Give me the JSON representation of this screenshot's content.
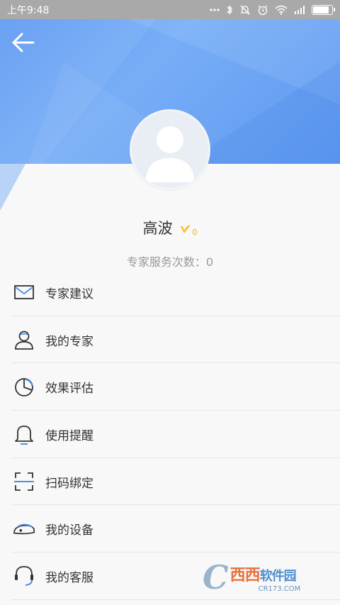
{
  "status_bar": {
    "time": "上午9:48",
    "icons": [
      "more-dots-icon",
      "bluetooth-icon",
      "mute-icon",
      "alarm-icon",
      "wifi-icon",
      "signal-icon",
      "battery-icon"
    ],
    "battery_level": 0.8
  },
  "header": {
    "back_icon": "arrow-left-icon",
    "color": "#5f9af3"
  },
  "profile": {
    "name": "高波",
    "vip_badge": "V",
    "vip_level": "0",
    "service_count_label": "专家服务次数：0"
  },
  "menu": [
    {
      "label": "专家建议",
      "icon": "mail-icon"
    },
    {
      "label": "我的专家",
      "icon": "expert-person-icon"
    },
    {
      "label": "效果评估",
      "icon": "pie-chart-icon"
    },
    {
      "label": "使用提醒",
      "icon": "bell-icon"
    },
    {
      "label": "扫码绑定",
      "icon": "scan-icon"
    },
    {
      "label": "我的设备",
      "icon": "device-icon"
    },
    {
      "label": "我的客服",
      "icon": "headset-icon"
    }
  ],
  "watermark": {
    "logo": "C",
    "main": "西西",
    "sub": "软件园",
    "url": "CR173.COM"
  },
  "colors": {
    "accent": "#5f9af3",
    "icon_blue": "#4a90e2",
    "text": "#333333",
    "muted": "#999999",
    "badge": "#f0c020"
  }
}
